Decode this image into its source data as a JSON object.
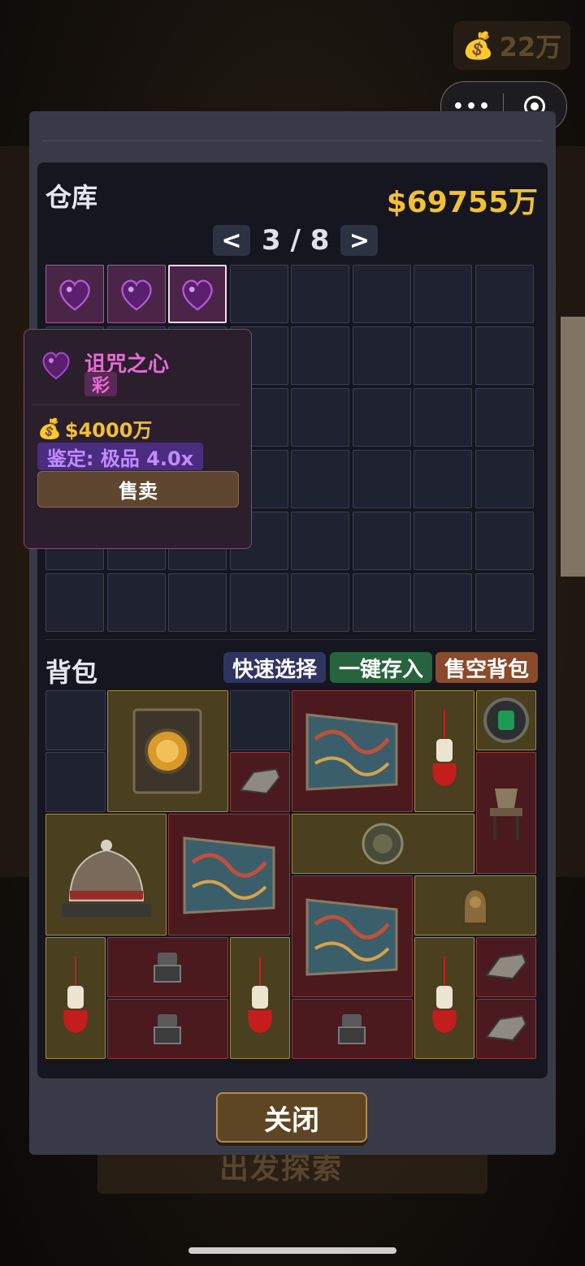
{
  "hud": {
    "money": "22万",
    "money_icon": "money-bag-icon"
  },
  "capsule": {
    "more_label": "•••"
  },
  "warehouse": {
    "title": "仓库",
    "balance": "$69755万",
    "pager": {
      "prev": "<",
      "page": "3 / 8",
      "next": ">"
    }
  },
  "tooltip": {
    "name": "诅咒之心",
    "rarity": "彩",
    "price": "$4000万",
    "appraisal": "鉴定: 极品 4.0x",
    "sell_label": "售卖"
  },
  "backpack": {
    "title": "背包",
    "quick_select": "快速选择",
    "deposit_all": "一键存入",
    "sell_all": "售空背包"
  },
  "close_label": "关闭",
  "background_text": "出发探索",
  "colors": {
    "accent_gold": "#f2c033",
    "rarity_pink": "#e86bd5",
    "appraisal_purple": "#c18bff",
    "quick_select_bg": "#2f3360",
    "deposit_bg": "#27633e",
    "sell_all_bg": "#8a4a2c"
  }
}
